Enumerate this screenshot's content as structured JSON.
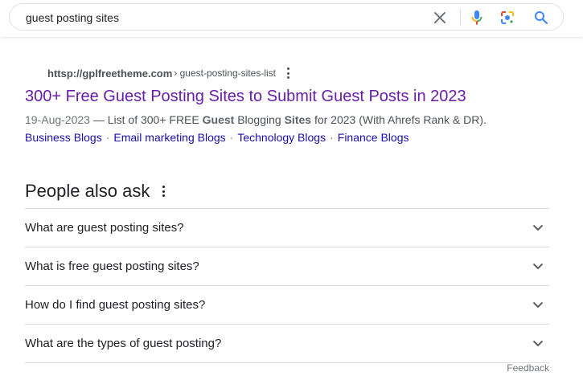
{
  "search": {
    "query": "guest posting sites"
  },
  "result": {
    "domain": "httsp://gplfreetheme.com",
    "path": "› guest-posting-sites-list",
    "title": "300+ Free Guest Posting Sites to Submit Guest Posts in 2023",
    "snippet": {
      "date": "19-Aug-2023",
      "dash": " — List of 300+ FREE ",
      "bold1": "Guest",
      "mid1": " Blogging ",
      "bold2": "Sites",
      "end": " for 2023 (With Ahrefs Rank & DR)."
    },
    "sitelinks": [
      "Business Blogs",
      "Email marketing Blogs",
      "Technology Blogs",
      "Finance Blogs"
    ],
    "sitelink_separator": "·"
  },
  "people_also_ask": {
    "title": "People also ask",
    "questions": [
      "What are guest posting sites?",
      "What is free guest posting sites?",
      "How do I find guest posting sites?",
      "What are the types of guest posting?"
    ]
  },
  "feedback": "Feedback",
  "icons": {
    "clear": "close-icon",
    "voice": "microphone-icon",
    "lens": "google-lens-icon",
    "search": "search-icon",
    "more": "more-vert-icon",
    "expand": "chevron-down-icon"
  },
  "colors": {
    "visited_link": "#681da8",
    "link": "#1a0dab",
    "search_blue": "#4285f4",
    "mic_red": "#ea4335"
  }
}
